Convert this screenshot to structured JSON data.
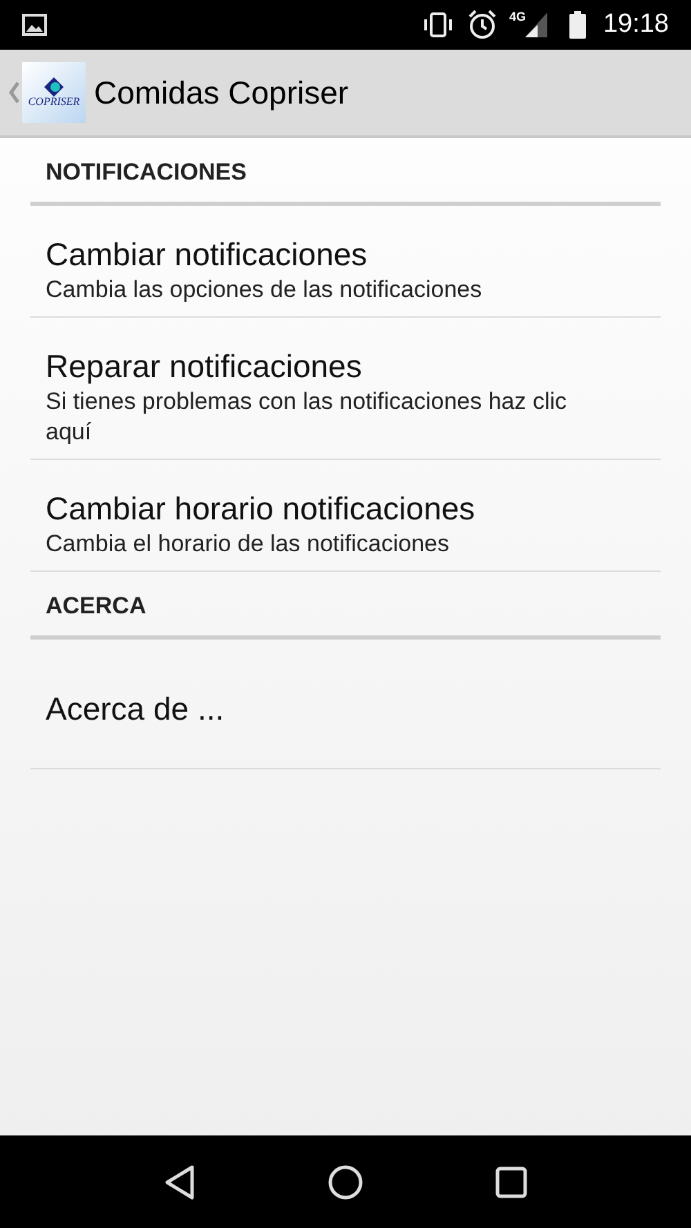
{
  "status_bar": {
    "time": "19:18",
    "network": "4G"
  },
  "app_bar": {
    "logo_text": "COPRISER",
    "title": "Comidas Copriser"
  },
  "sections": [
    {
      "title": "NOTIFICACIONES",
      "items": [
        {
          "title": "Cambiar notificaciones",
          "summary": "Cambia las opciones de las notificaciones"
        },
        {
          "title": "Reparar notificaciones",
          "summary": "Si tienes problemas con las notificaciones haz clic aquí"
        },
        {
          "title": "Cambiar horario notificaciones",
          "summary": "Cambia el horario de las notificaciones"
        }
      ]
    },
    {
      "title": "ACERCA",
      "items": [
        {
          "title": "Acerca de ..."
        }
      ]
    }
  ]
}
